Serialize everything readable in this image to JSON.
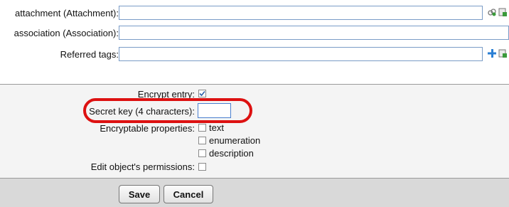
{
  "form": {
    "fields": [
      {
        "label": "attachment (Attachment):",
        "value": ""
      },
      {
        "label": "association (Association):",
        "value": ""
      },
      {
        "label": "Referred tags:",
        "value": ""
      }
    ]
  },
  "encryption": {
    "encrypt_label": "Encrypt entry:",
    "encrypt_checked": true,
    "secret_label": "Secret key (4 characters):",
    "secret_value": "",
    "props_label": "Encryptable properties:",
    "props": [
      "text",
      "enumeration",
      "description"
    ],
    "permissions_label": "Edit object's permissions:"
  },
  "actions": {
    "save": "Save",
    "cancel": "Cancel"
  },
  "colors": {
    "highlight": "#dd1111",
    "input_border": "#7a9cc7",
    "plus_icon": "#2a7fd4"
  }
}
